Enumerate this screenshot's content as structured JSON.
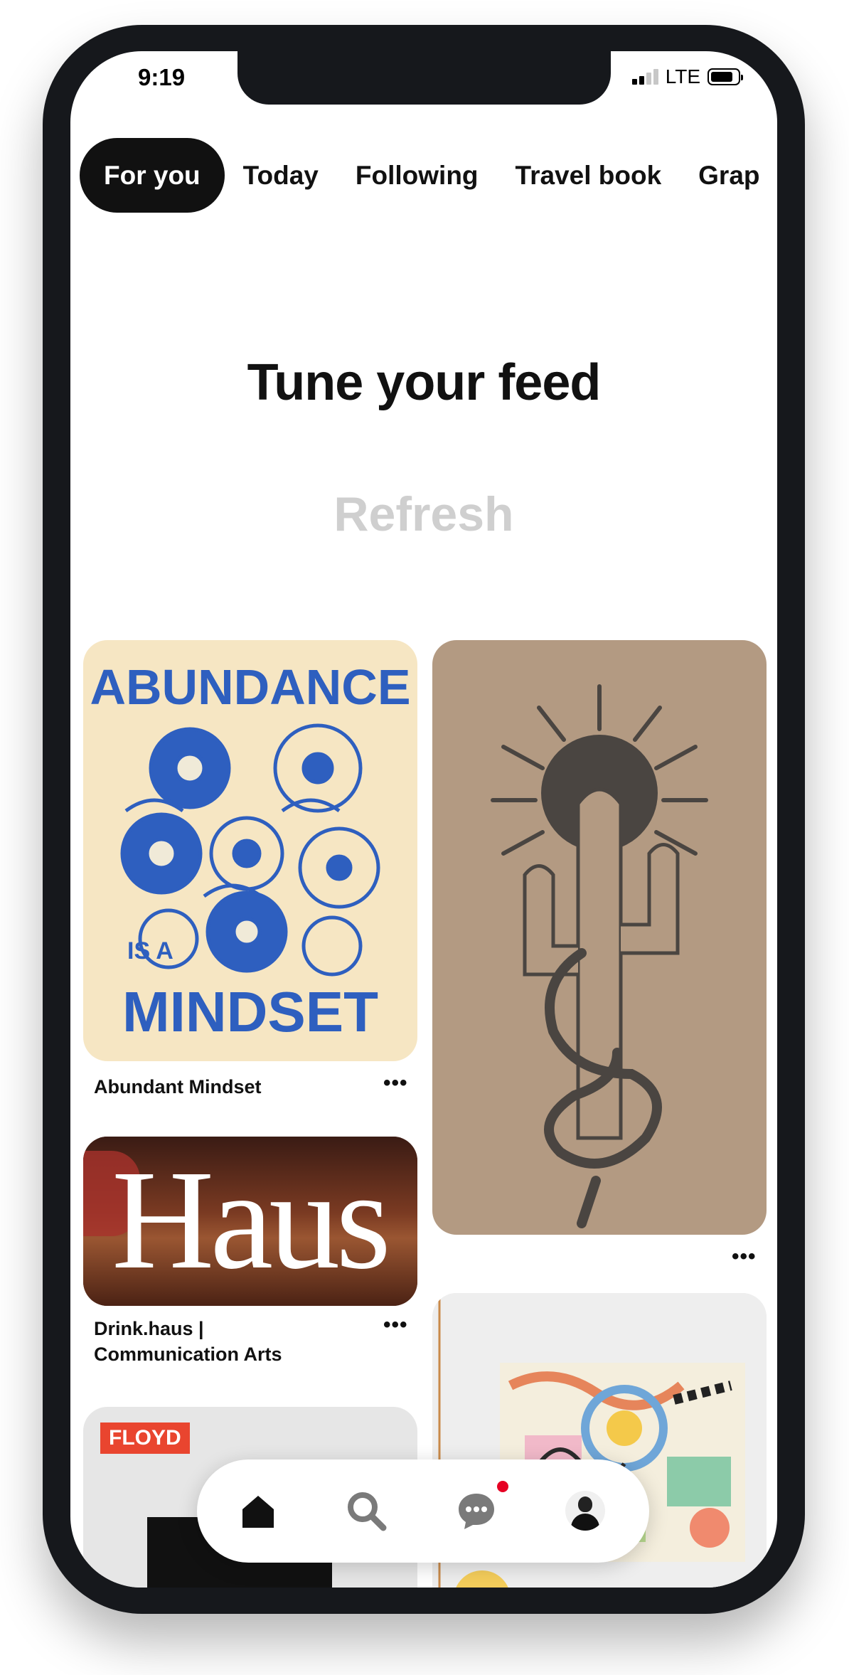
{
  "status": {
    "time": "9:19",
    "network": "LTE"
  },
  "tabs": [
    "For you",
    "Today",
    "Following",
    "Travel book",
    "Grap"
  ],
  "feed": {
    "heading": "Tune your feed",
    "refresh_label": "Refresh"
  },
  "pins": {
    "abundance": {
      "title": "Abundant Mindset",
      "art_text_top": "ABUNDANCE",
      "art_text_mid": "IS A",
      "art_text_bottom": "MINDSET",
      "bg_color": "#f6e6c3",
      "accent_color": "#2e5fbf"
    },
    "cactus": {
      "bg_color": "#b39a82",
      "ink_color": "#4a4541"
    },
    "haus": {
      "title_line1": "Drink.haus |",
      "title_line2": "Communication Arts",
      "art_text": "Haus"
    },
    "floyd": {
      "label": "FLOYD",
      "label_color": "#e9452f"
    },
    "painting": {}
  },
  "more_label": "•••",
  "nav": {
    "items": [
      "home-icon",
      "search-icon",
      "messages-icon",
      "profile-avatar"
    ],
    "notification_color": "#e60023"
  }
}
